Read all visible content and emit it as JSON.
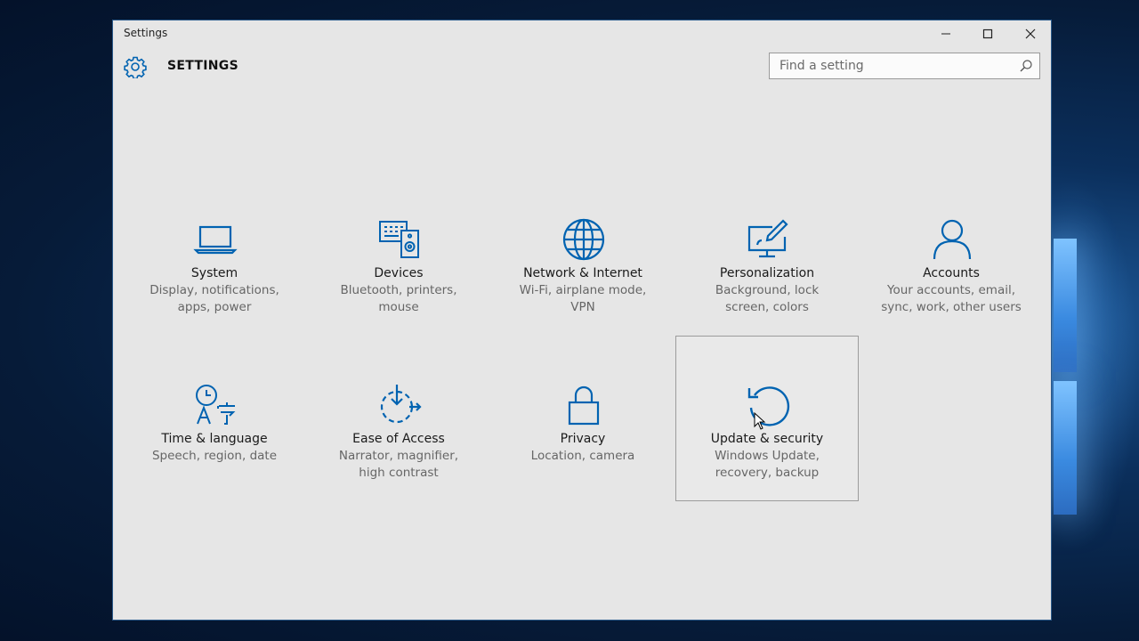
{
  "window": {
    "title": "Settings"
  },
  "header": {
    "title": "SETTINGS",
    "search_placeholder": "Find a setting"
  },
  "accent_color": "#0063b1",
  "tiles": [
    {
      "name": "System",
      "desc_1": "Display, notifications,",
      "desc_2": "apps, power",
      "icon": "laptop-icon"
    },
    {
      "name": "Devices",
      "desc_1": "Bluetooth, printers,",
      "desc_2": "mouse",
      "icon": "devices-icon"
    },
    {
      "name": "Network & Internet",
      "desc_1": "Wi-Fi, airplane mode,",
      "desc_2": "VPN",
      "icon": "globe-icon"
    },
    {
      "name": "Personalization",
      "desc_1": "Background, lock",
      "desc_2": "screen, colors",
      "icon": "paint-monitor-icon"
    },
    {
      "name": "Accounts",
      "desc_1": "Your accounts, email,",
      "desc_2": "sync, work, other users",
      "icon": "person-icon"
    },
    {
      "name": "Time & language",
      "desc_1": "Speech, region, date",
      "desc_2": "",
      "icon": "time-language-icon"
    },
    {
      "name": "Ease of Access",
      "desc_1": "Narrator, magnifier,",
      "desc_2": "high contrast",
      "icon": "ease-of-access-icon"
    },
    {
      "name": "Privacy",
      "desc_1": "Location, camera",
      "desc_2": "",
      "icon": "lock-icon"
    },
    {
      "name": "Update & security",
      "desc_1": "Windows Update,",
      "desc_2": "recovery, backup",
      "icon": "refresh-icon"
    }
  ]
}
